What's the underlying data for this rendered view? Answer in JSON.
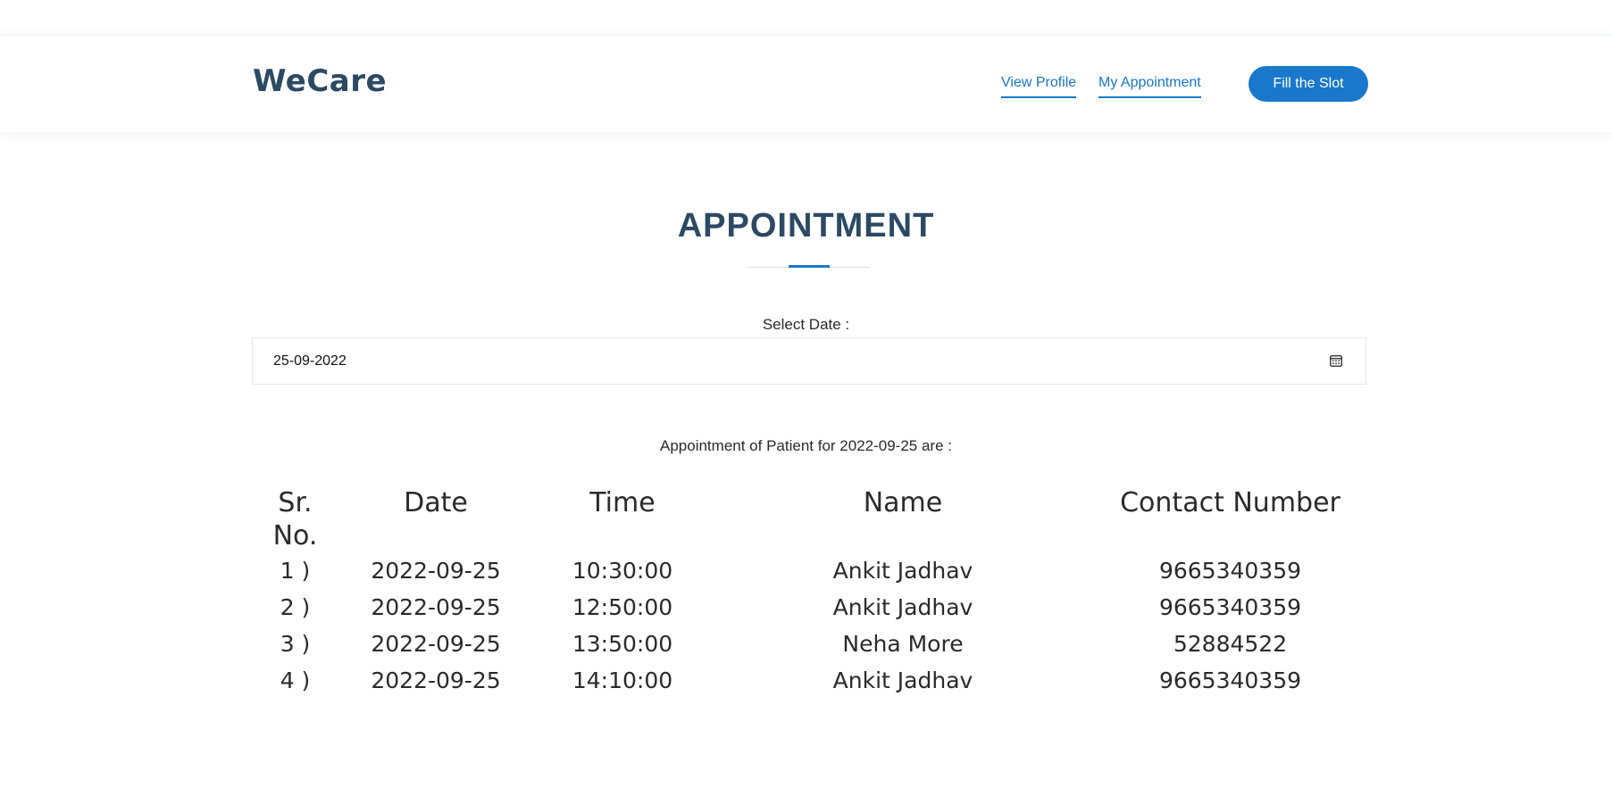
{
  "header": {
    "logo": "WeCare",
    "nav": [
      {
        "label": "View Profile"
      },
      {
        "label": "My Appointment"
      }
    ],
    "cta_label": "Fill the Slot"
  },
  "page": {
    "title": "APPOINTMENT",
    "date_label": "Select Date :",
    "date_value": "25-09-2022",
    "calendar_icon": "calendar-icon",
    "caption": "Appointment of Patient for 2022-09-25 are :"
  },
  "table": {
    "headers": [
      "Sr. No.",
      "Date",
      "Time",
      "Name",
      "Contact Number"
    ],
    "rows": [
      {
        "sr": "1 )",
        "date": "2022-09-25",
        "time": "10:30:00",
        "name": "Ankit Jadhav",
        "contact": "9665340359"
      },
      {
        "sr": "2 )",
        "date": "2022-09-25",
        "time": "12:50:00",
        "name": "Ankit Jadhav",
        "contact": "9665340359"
      },
      {
        "sr": "3 )",
        "date": "2022-09-25",
        "time": "13:50:00",
        "name": "Neha More",
        "contact": "52884522"
      },
      {
        "sr": "4 )",
        "date": "2022-09-25",
        "time": "14:10:00",
        "name": "Ankit Jadhav",
        "contact": "9665340359"
      }
    ]
  },
  "colors": {
    "primary": "#1977cc",
    "heading": "#2c4964",
    "text": "#2a2a2a"
  }
}
